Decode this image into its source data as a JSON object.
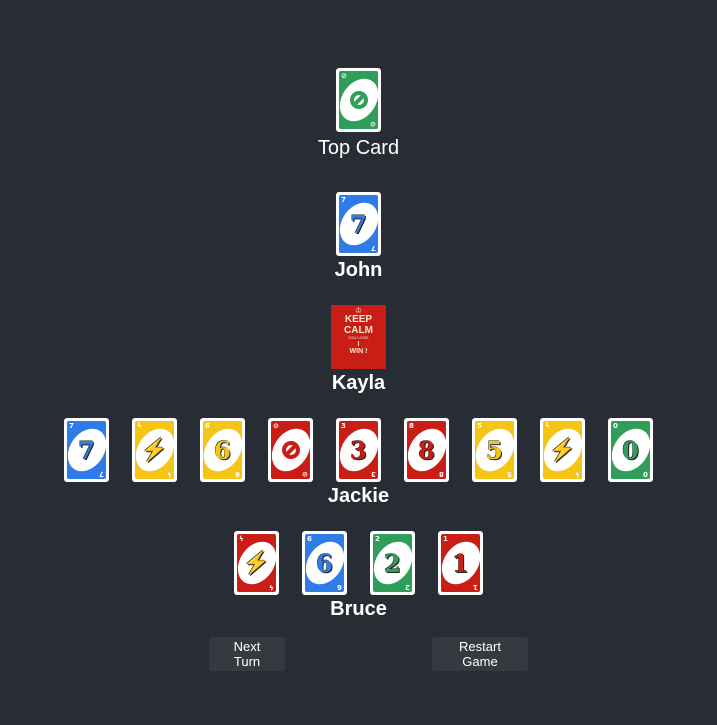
{
  "colors": {
    "background": "#282c34",
    "red": "#c91e16",
    "blue": "#2f7be8",
    "green": "#2e9e58",
    "yellow": "#f5c515",
    "button": "#343a40"
  },
  "top_card": {
    "label": "Top Card",
    "card": {
      "color": "green",
      "symbol": "skip"
    }
  },
  "players": [
    {
      "name": "John",
      "cards": [
        {
          "color": "blue",
          "symbol": "7"
        }
      ]
    },
    {
      "name": "Kayla",
      "special": {
        "crown": "♔",
        "line1": "KEEP",
        "line2": "CALM",
        "line3": "YOU LOSE,",
        "line4": "I",
        "line5": "WIN !"
      }
    },
    {
      "name": "Jackie",
      "cards": [
        {
          "color": "blue",
          "symbol": "7"
        },
        {
          "color": "yellow",
          "symbol": "wild"
        },
        {
          "color": "yellow",
          "symbol": "6"
        },
        {
          "color": "red",
          "symbol": "skip"
        },
        {
          "color": "red",
          "symbol": "3"
        },
        {
          "color": "red",
          "symbol": "8"
        },
        {
          "color": "yellow",
          "symbol": "5"
        },
        {
          "color": "yellow",
          "symbol": "wild"
        },
        {
          "color": "green",
          "symbol": "0"
        }
      ]
    },
    {
      "name": "Bruce",
      "cards": [
        {
          "color": "red",
          "symbol": "wild"
        },
        {
          "color": "blue",
          "symbol": "6"
        },
        {
          "color": "green",
          "symbol": "2"
        },
        {
          "color": "red",
          "symbol": "1"
        }
      ]
    }
  ],
  "buttons": {
    "next_turn": "Next Turn",
    "restart_game": "Restart Game"
  }
}
